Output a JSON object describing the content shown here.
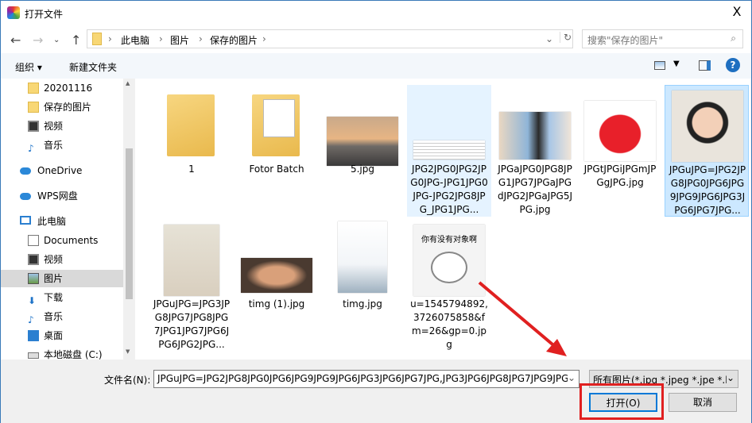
{
  "window": {
    "title": "打开文件",
    "close": "X"
  },
  "address": {
    "crumbs": [
      "此电脑",
      "图片",
      "保存的图片"
    ],
    "search_placeholder": "搜索\"保存的图片\""
  },
  "toolbar": {
    "organize": "组织 ▾",
    "new_folder": "新建文件夹",
    "help": "?"
  },
  "sidebar": {
    "items": [
      "20201116",
      "保存的图片",
      "视频",
      "音乐",
      "OneDrive",
      "WPS网盘",
      "此电脑",
      "Documents",
      "视频",
      "图片",
      "下载",
      "音乐",
      "桌面",
      "本地磁盘 (C:)"
    ]
  },
  "files": [
    {
      "name": "1"
    },
    {
      "name": "Fotor Batch"
    },
    {
      "name": "5.jpg"
    },
    {
      "name": "JPG2JPG0JPG2JPG0JPG-JPG1JPG0JPG-JPG2JPG8JPG_JPG1JPG..."
    },
    {
      "name": "JPGaJPG0JPG8JPG1JPG7JPGaJPGdJPG2JPGaJPG5JPG.jpg"
    },
    {
      "name": "JPGtJPGiJPGmJPGgJPG.jpg"
    },
    {
      "name": "JPGuJPG=JPG2JPG8JPG0JPG6JPG9JPG9JPG6JPG3JPG6JPG7JPG..."
    },
    {
      "name": "JPGuJPG=JPG3JPG8JPG7JPG8JPG7JPG1JPG7JPG6JPG6JPG2JPG..."
    },
    {
      "name": "timg (1).jpg"
    },
    {
      "name": "timg.jpg"
    },
    {
      "name": "u=1545794892,3726075858&fm=26&gp=0.jpg"
    }
  ],
  "thumb_text": {
    "meme": "你有没有对象啊"
  },
  "bottom": {
    "filename_label": "文件名(N):",
    "filename_value": "JPGuJPG=JPG2JPG8JPG0JPG6JPG9JPG9JPG6JPG3JPG6JPG7JPG,JPG3JPG6JPG8JPG7JPG9JPG",
    "filter": "所有图片(*.jpg *.jpeg *.jpe *.b",
    "open": "打开(O)",
    "cancel": "取消"
  },
  "colors": {
    "accent": "#0078d7",
    "highlight": "#e02020"
  }
}
